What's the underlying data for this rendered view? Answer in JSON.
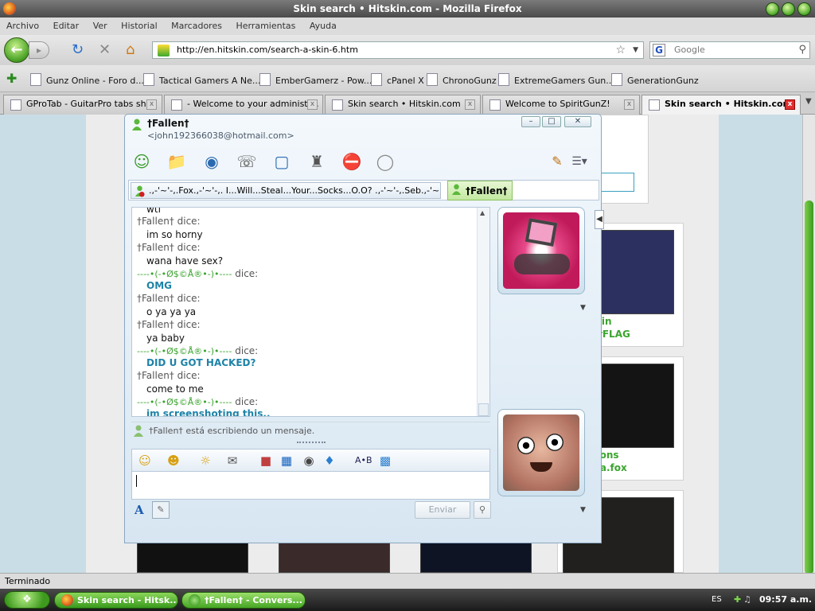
{
  "firefox": {
    "title": "Skin search • Hitskin.com - Mozilla Firefox",
    "menu": [
      "Archivo",
      "Editar",
      "Ver",
      "Historial",
      "Marcadores",
      "Herramientas",
      "Ayuda"
    ],
    "url": "http://en.hitskin.com/search-a-skin-6.htm",
    "search_placeholder": "Google",
    "bookmarks": [
      "Gunz Online - Foro d...",
      "Tactical Gamers A Ne...",
      "EmberGamerz - Pow...",
      "cPanel X",
      "ChronoGunz",
      "ExtremeGamers Gun...",
      "GenerationGunz"
    ],
    "tabs": [
      "GProTab - GuitarPro tabs sh...",
      "- Welcome to your administr...",
      "Skin search • Hitskin.com",
      "Welcome to SpiritGunZ!",
      "Skin search • Hitskin.com"
    ],
    "status": "Terminado"
  },
  "page": {
    "label1a": "digo skin",
    "label1b": "ATCHurFLAG",
    "label2a": "ta buttons",
    "label2b": "itedkilla.fox",
    "partial_button": "h"
  },
  "msn": {
    "contact_name": "†Fallen†",
    "contact_email": "<john192366038@hotmail.com>",
    "tab_other": ".,-'~'-,.Fox.,-'~'-,. I...Will...Steal...Your...Socks...O.O? .,-'~'-,.Seb.,-'~'-,.",
    "tab_active": "†Fallen†",
    "messages": [
      {
        "who": "",
        "text": "wtf"
      },
      {
        "who": "†Fallen† dice:",
        "text": "im so horny"
      },
      {
        "who": "†Fallen† dice:",
        "text": "wana have sex?"
      },
      {
        "who": "----•(-•Ø$©Å®•-)•----",
        "who_suffix": " dice:",
        "text": "OMG"
      },
      {
        "who": "†Fallen† dice:",
        "text": "o ya ya ya"
      },
      {
        "who": "†Fallen† dice:",
        "text": "ya baby"
      },
      {
        "who": "----•(-•Ø$©Å®•-)•----",
        "who_suffix": " dice:",
        "text": "DID U GOT HACKED?"
      },
      {
        "who": "†Fallen† dice:",
        "text": "come to me"
      },
      {
        "who": "----•(-•Ø$©Å®•-)•----",
        "who_suffix": " dice:",
        "text": "im screenshoting this.."
      }
    ],
    "typing_status": "†Fallen† está escribiendo un mensaje.",
    "send_label": "Enviar"
  },
  "taskbar": {
    "tasks": [
      "Skin search - Hitsk...",
      "†Fallen† - Convers..."
    ],
    "lang": "ES",
    "time": "09:57 a.m."
  },
  "colors": {
    "accent_green": "#3aa42e",
    "msn_blue": "#1e83a8"
  }
}
